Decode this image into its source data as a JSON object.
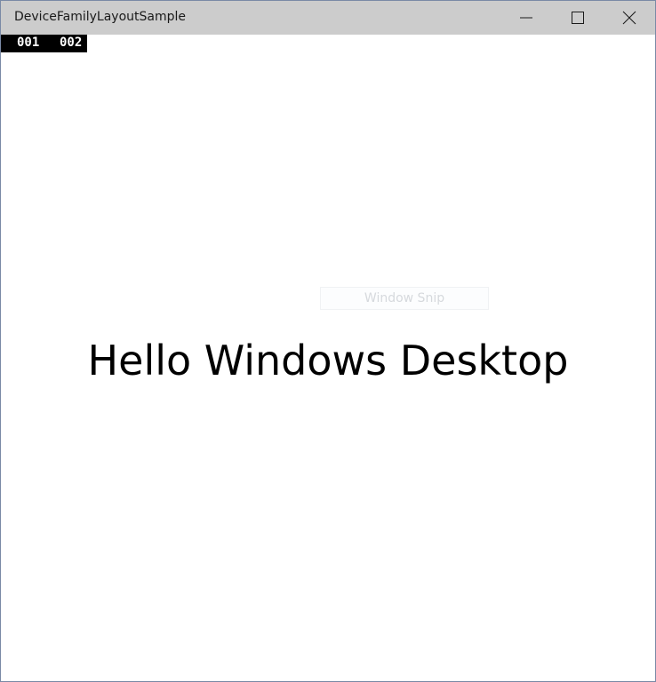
{
  "window": {
    "title": "DeviceFamilyLayoutSample",
    "controls": {
      "minimize_icon": "minimize-icon",
      "maximize_icon": "maximize-icon",
      "close_icon": "close-icon"
    }
  },
  "frame_counter": {
    "value_a": "001",
    "value_b": "002"
  },
  "overlay": {
    "window_snip_label": "Window Snip"
  },
  "main": {
    "greeting": "Hello Windows Desktop"
  },
  "colors": {
    "titlebar": "#cccccc",
    "window_border": "#7a8aa6",
    "counter_bg": "#000000",
    "counter_text": "#ffffff"
  }
}
